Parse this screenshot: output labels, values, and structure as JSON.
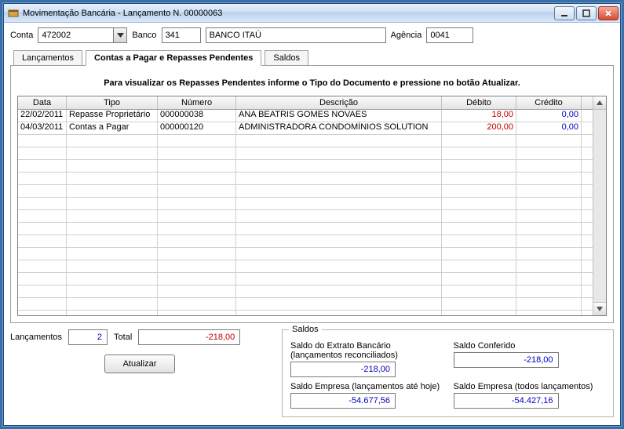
{
  "window": {
    "title": "Movimentação Bancária - Lançamento N. 00000063"
  },
  "header": {
    "conta_label": "Conta",
    "conta_value": "472002",
    "banco_label": "Banco",
    "banco_code": "341",
    "banco_name": "BANCO ITAÚ",
    "agencia_label": "Agência",
    "agencia_value": "0041"
  },
  "tabs": {
    "lancamentos": "Lançamentos",
    "contas": "Contas a Pagar e Repasses Pendentes",
    "saldos": "Saldos"
  },
  "instruction": "Para visualizar os Repasses Pendentes informe o Tipo do Documento e pressione no botão Atualizar.",
  "grid": {
    "headers": {
      "data": "Data",
      "tipo": "Tipo",
      "numero": "Número",
      "descricao": "Descrição",
      "debito": "Débito",
      "credito": "Crédito"
    },
    "rows": [
      {
        "data": "22/02/2011",
        "tipo": "Repasse Proprietário",
        "numero": "000000038",
        "descricao": "ANA BEATRIS GOMES NOVAES",
        "debito": "18,00",
        "credito": "0,00"
      },
      {
        "data": "04/03/2011",
        "tipo": "Contas a Pagar",
        "numero": "000000120",
        "descricao": "ADMINISTRADORA CONDOMÍNIOS SOLUTION",
        "debito": "200,00",
        "credito": "0,00"
      }
    ]
  },
  "totals": {
    "lancamentos_label": "Lançamentos",
    "lancamentos_value": "2",
    "total_label": "Total",
    "total_value": "-218,00",
    "atualizar_label": "Atualizar"
  },
  "saldos": {
    "legend": "Saldos",
    "extrato_label": "Saldo do Extrato Bancário (lançamentos reconciliados)",
    "extrato_value": "-218,00",
    "conferido_label": "Saldo Conferido",
    "conferido_value": "-218,00",
    "empresa_hoje_label": "Saldo Empresa (lançamentos até hoje)",
    "empresa_hoje_value": "-54.677,56",
    "empresa_todos_label": "Saldo Empresa (todos lançamentos)",
    "empresa_todos_value": "-54.427,16"
  }
}
